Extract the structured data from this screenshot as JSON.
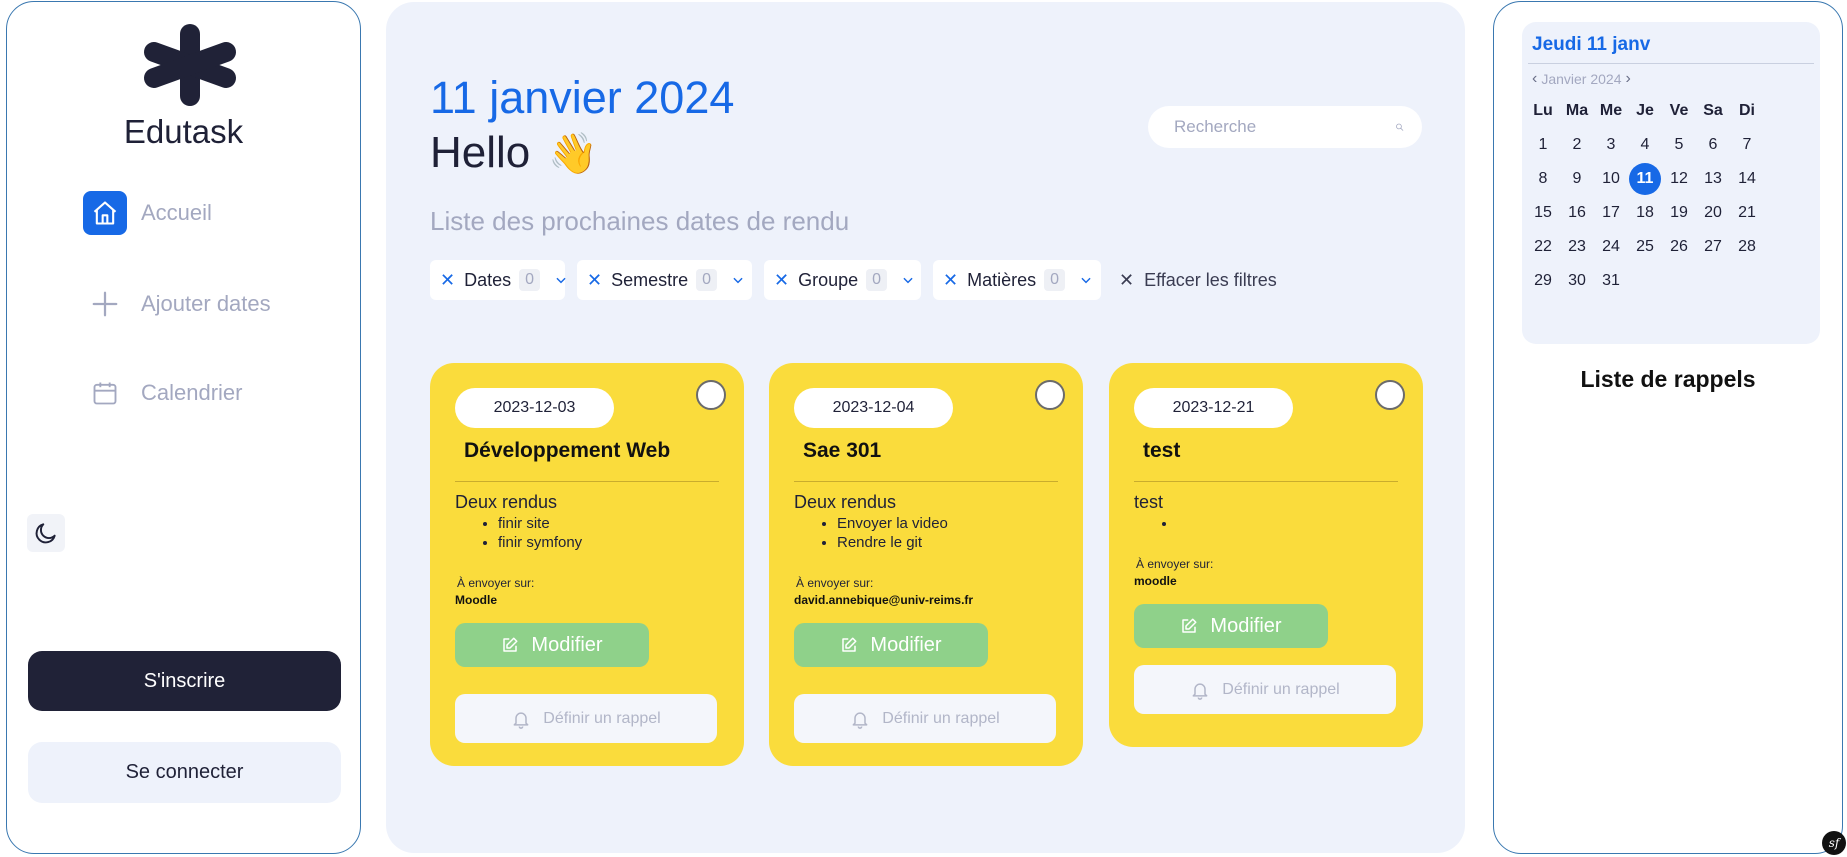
{
  "app": {
    "name": "Edutask"
  },
  "sidebar": {
    "nav": [
      {
        "label": "Accueil",
        "icon": "home-icon",
        "active": true
      },
      {
        "label": "Ajouter dates",
        "icon": "plus-icon",
        "active": false
      },
      {
        "label": "Calendrier",
        "icon": "calendar-icon",
        "active": false
      }
    ],
    "theme_icon": "moon-icon",
    "register_label": "S'inscrire",
    "login_label": "Se connecter"
  },
  "main": {
    "date_title": "11 janvier 2024",
    "greeting": "Hello",
    "greeting_emoji": "👋",
    "subtitle": "Liste des prochaines dates de rendu",
    "search": {
      "placeholder": "Recherche",
      "value": ""
    },
    "filters": [
      {
        "label": "Dates",
        "count": "0"
      },
      {
        "label": "Semestre",
        "count": "0"
      },
      {
        "label": "Groupe",
        "count": "0"
      },
      {
        "label": "Matières",
        "count": "0"
      }
    ],
    "clear_filters_label": "Effacer les filtres",
    "cards": [
      {
        "date": "2023-12-03",
        "title": "Développement Web",
        "description": "Deux rendus",
        "items": [
          "finir site",
          "finir symfony"
        ],
        "send_label": "À envoyer sur:",
        "send_value": "Moodle",
        "modify_label": "Modifier",
        "reminder_label": "Définir un rappel"
      },
      {
        "date": "2023-12-04",
        "title": "Sae 301",
        "description": "Deux rendus",
        "items": [
          "Envoyer la video",
          "Rendre le git"
        ],
        "send_label": "À envoyer sur:",
        "send_value": "david.annebique@univ-reims.fr",
        "modify_label": "Modifier",
        "reminder_label": "Définir un rappel"
      },
      {
        "date": "2023-12-21",
        "title": "test",
        "description": "test",
        "items": [
          ""
        ],
        "send_label": "À envoyer sur:",
        "send_value": "moodle",
        "modify_label": "Modifier",
        "reminder_label": "Définir un rappel"
      }
    ]
  },
  "calendar": {
    "heading": "Jeudi 11 janv",
    "month_label": "Janvier 2024",
    "weekdays": [
      "Lu",
      "Ma",
      "Me",
      "Je",
      "Ve",
      "Sa",
      "Di"
    ],
    "days": [
      "1",
      "2",
      "3",
      "4",
      "5",
      "6",
      "7",
      "8",
      "9",
      "10",
      "11",
      "12",
      "13",
      "14",
      "15",
      "16",
      "17",
      "18",
      "19",
      "20",
      "21",
      "22",
      "23",
      "24",
      "25",
      "26",
      "27",
      "28",
      "29",
      "30",
      "31"
    ],
    "today": "11"
  },
  "reminders": {
    "title": "Liste de rappels"
  },
  "colors": {
    "accent": "#1769e6",
    "card": "#fadc3c",
    "modify_button": "#8fd18a",
    "dark_button": "#202237",
    "panel_bg": "#eef2fb"
  }
}
